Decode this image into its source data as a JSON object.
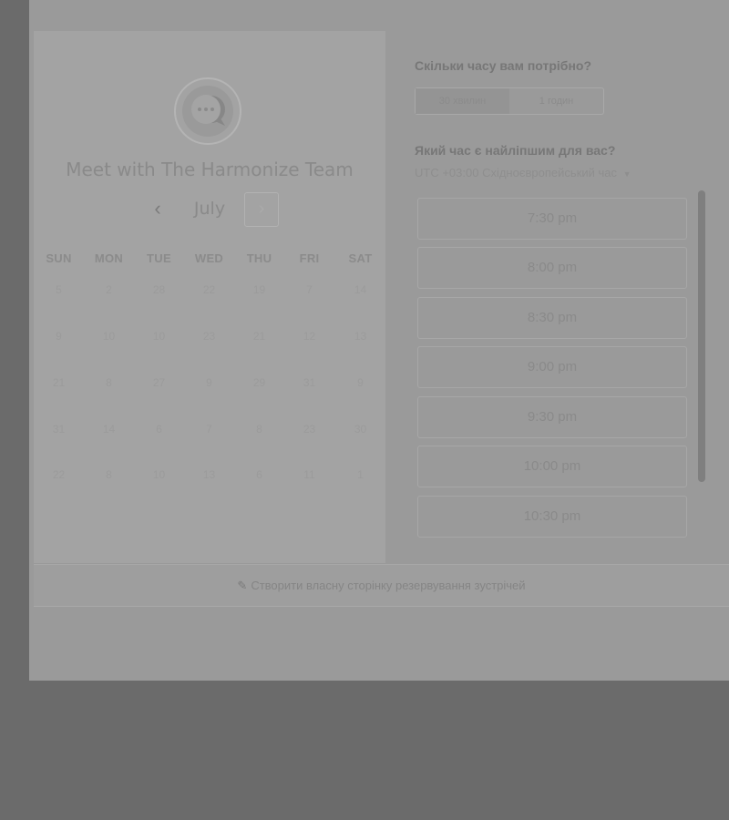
{
  "host": {
    "title": "Meet with The Harmonize Team",
    "avatar_icon": "chat-bubble-icon"
  },
  "calendar": {
    "month": "July",
    "prev_icon": "‹",
    "next_icon": "›",
    "weekdays": [
      "SUN",
      "MON",
      "TUE",
      "WED",
      "THU",
      "FRI",
      "SAT"
    ],
    "weeks": [
      [
        "5",
        "2",
        "28",
        "22",
        "19",
        "7",
        "14"
      ],
      [
        "9",
        "10",
        "10",
        "23",
        "21",
        "12",
        "13"
      ],
      [
        "21",
        "8",
        "27",
        "9",
        "29",
        "31",
        "9"
      ],
      [
        "31",
        "14",
        "6",
        "7",
        "8",
        "23",
        "30"
      ],
      [
        "22",
        "8",
        "10",
        "13",
        "6",
        "11",
        "1"
      ]
    ]
  },
  "duration": {
    "question": "Скільки часу вам потрібно?",
    "options": [
      "30 хвилин",
      "1 годин"
    ],
    "selected": "30 хвилин"
  },
  "time": {
    "question": "Який час є найліпшим для вас?",
    "timezone": "UTC +03:00 Східноєвропейський час",
    "slots": [
      "7:30 pm",
      "8:00 pm",
      "8:30 pm",
      "9:00 pm",
      "9:30 pm",
      "10:00 pm",
      "10:30 pm"
    ]
  },
  "footer": {
    "link": "Створити власну сторінку резервування зустрічей"
  }
}
